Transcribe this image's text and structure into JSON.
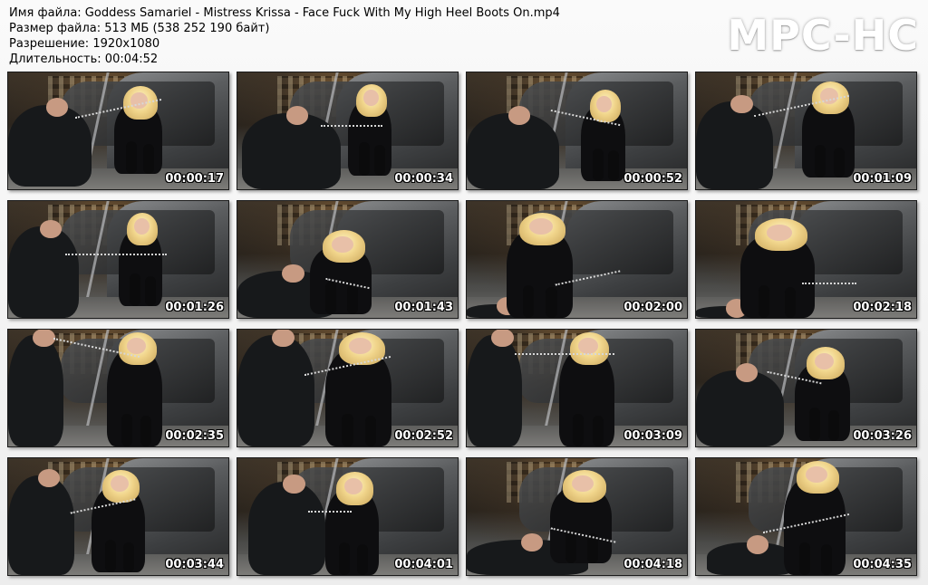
{
  "header": {
    "filename_line": "Имя файла: Goddess Samariel - Mistress Krissa - Face Fuck With My High Heel Boots On.mp4",
    "size_line": "Размер файла: 513 МБ (538 252 190 байт)",
    "resolution_line": "Разрешение: 1920x1080",
    "duration_line": "Длительность: 00:04:52"
  },
  "brand": {
    "logo_text": "MPC-HC",
    "color": "#ffffff"
  },
  "thumbnails": [
    {
      "timecode": "00:00:17"
    },
    {
      "timecode": "00:00:34"
    },
    {
      "timecode": "00:00:52"
    },
    {
      "timecode": "00:01:09"
    },
    {
      "timecode": "00:01:26"
    },
    {
      "timecode": "00:01:43"
    },
    {
      "timecode": "00:02:00"
    },
    {
      "timecode": "00:02:18"
    },
    {
      "timecode": "00:02:35"
    },
    {
      "timecode": "00:02:52"
    },
    {
      "timecode": "00:03:09"
    },
    {
      "timecode": "00:03:26"
    },
    {
      "timecode": "00:03:44"
    },
    {
      "timecode": "00:04:01"
    },
    {
      "timecode": "00:04:18"
    },
    {
      "timecode": "00:04:35"
    }
  ]
}
